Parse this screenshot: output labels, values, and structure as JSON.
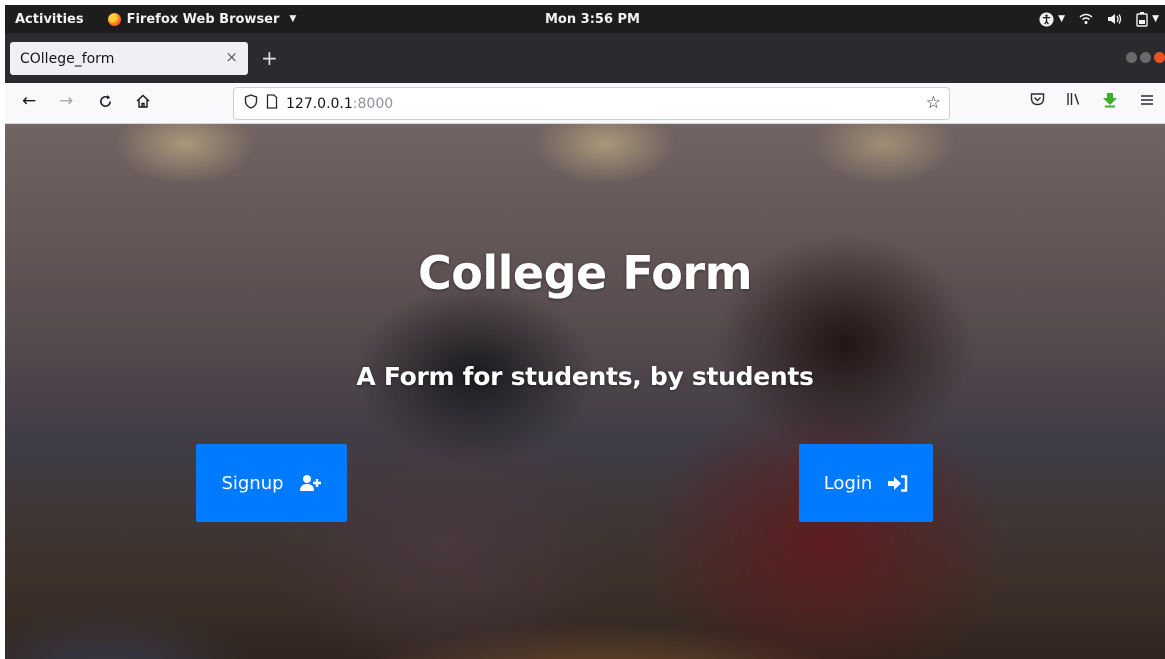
{
  "topbar": {
    "activities": "Activities",
    "app_name": "Firefox Web Browser",
    "clock": "Mon  3:56 PM"
  },
  "browser": {
    "tab_title": "COllege_form",
    "url_host": "127.0.0.1",
    "url_port": ":8000"
  },
  "page": {
    "title": "College Form",
    "subtitle": "A Form for students, by students",
    "signup_label": "Signup",
    "login_label": "Login"
  },
  "colors": {
    "button": "#007bff",
    "topbar": "#1d1d1d",
    "tabstrip": "#2b2a2e"
  },
  "icons": {
    "signup": "user-plus-icon",
    "login": "sign-in-icon"
  }
}
